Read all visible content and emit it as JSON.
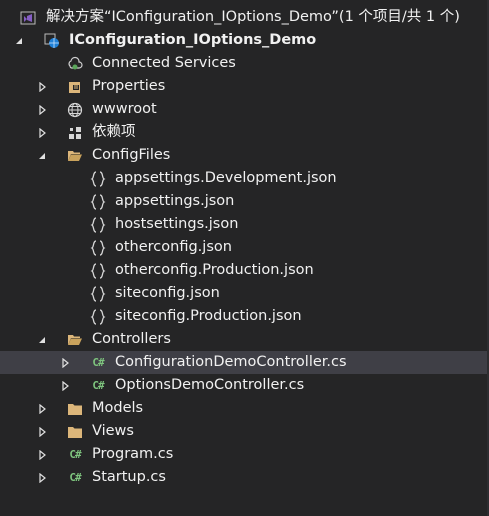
{
  "colors": {
    "background": "#252526",
    "text": "#f1f1f1",
    "selection": "#3f3f46",
    "folder": "#dcb67a",
    "csharp": "#7ec47e",
    "vs_purple": "#865fc5"
  },
  "solution": {
    "label": "解决方案“IConfiguration_IOptions_Demo”(1 个项目/共 1 个)",
    "icon": "vs-solution-icon"
  },
  "project": {
    "label": "IConfiguration_IOptions_Demo",
    "icon": "web-project-icon",
    "expanded": true
  },
  "items": [
    {
      "label": "Connected Services",
      "icon": "connected-services-icon",
      "expander": "none"
    },
    {
      "label": "Properties",
      "icon": "properties-icon",
      "expander": "collapsed"
    },
    {
      "label": "wwwroot",
      "icon": "globe-icon",
      "expander": "collapsed"
    },
    {
      "label": "依赖项",
      "icon": "dependencies-icon",
      "expander": "collapsed"
    },
    {
      "label": "ConfigFiles",
      "icon": "folder-open-icon",
      "expander": "expanded",
      "children": [
        {
          "label": "appsettings.Development.json",
          "icon": "json-file-icon"
        },
        {
          "label": "appsettings.json",
          "icon": "json-file-icon"
        },
        {
          "label": "hostsettings.json",
          "icon": "json-file-icon"
        },
        {
          "label": "otherconfig.json",
          "icon": "json-file-icon"
        },
        {
          "label": "otherconfig.Production.json",
          "icon": "json-file-icon"
        },
        {
          "label": "siteconfig.json",
          "icon": "json-file-icon"
        },
        {
          "label": "siteconfig.Production.json",
          "icon": "json-file-icon"
        }
      ]
    },
    {
      "label": "Controllers",
      "icon": "folder-open-icon",
      "expander": "expanded",
      "children": [
        {
          "label": "ConfigurationDemoController.cs",
          "icon": "csharp-file-icon",
          "selected": true
        },
        {
          "label": "OptionsDemoController.cs",
          "icon": "csharp-file-icon"
        }
      ]
    },
    {
      "label": "Models",
      "icon": "folder-icon",
      "expander": "collapsed"
    },
    {
      "label": "Views",
      "icon": "folder-icon",
      "expander": "collapsed"
    },
    {
      "label": "Program.cs",
      "icon": "csharp-file-icon",
      "expander": "collapsed"
    },
    {
      "label": "Startup.cs",
      "icon": "csharp-file-icon",
      "expander": "collapsed"
    }
  ]
}
